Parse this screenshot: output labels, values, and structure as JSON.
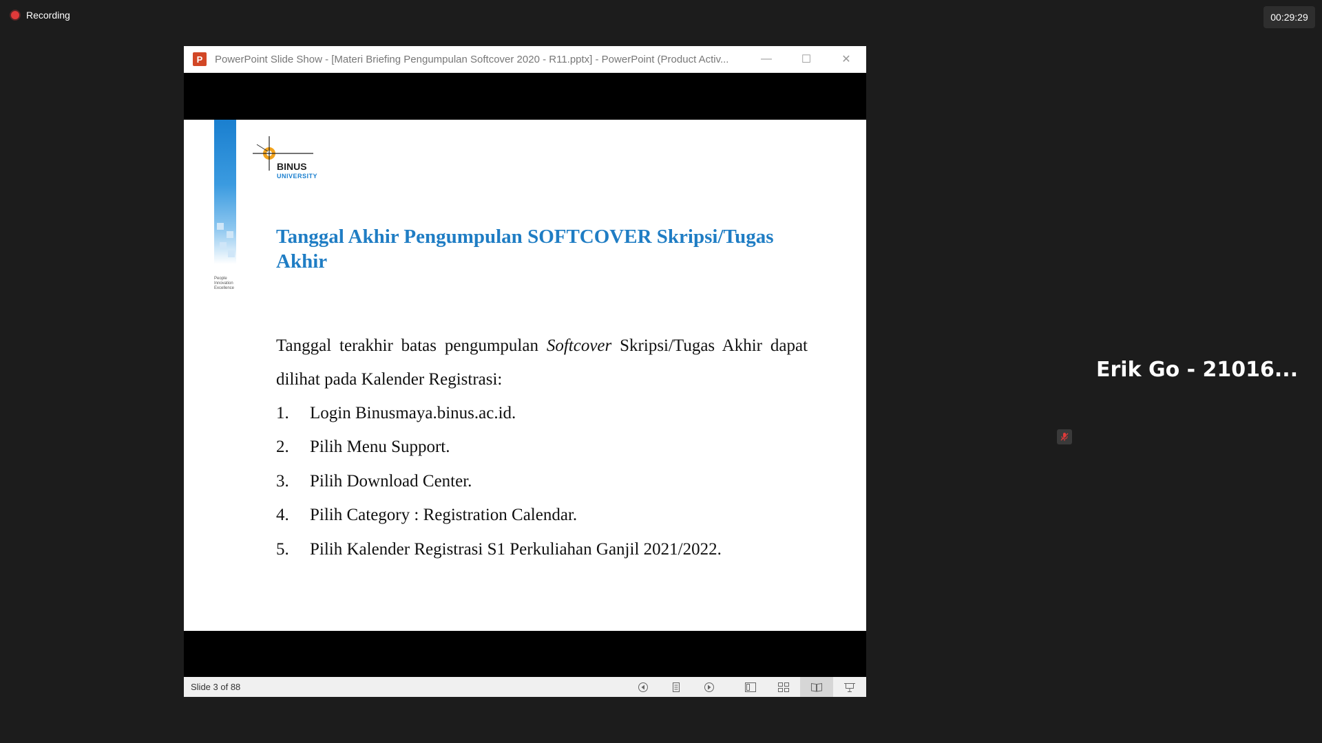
{
  "recording": {
    "label": "Recording"
  },
  "timer": {
    "value": "00:29:29"
  },
  "window": {
    "title": "PowerPoint Slide Show - [Materi Briefing Pengumpulan Softcover 2020 - R11.pptx] - PowerPoint (Product Activ...",
    "app_icon": "P",
    "controls": {
      "minimize": "—",
      "maximize": "☐",
      "close": "✕"
    }
  },
  "slide": {
    "logo": {
      "name": "BINUS",
      "sub": "UNIVERSITY"
    },
    "tagline": [
      "People",
      "Innovation",
      "Excellence"
    ],
    "title": "Tanggal Akhir Pengumpulan SOFTCOVER Skripsi/Tugas Akhir",
    "intro_before": "Tanggal terakhir batas pengumpulan ",
    "intro_italic": "Softcover",
    "intro_after": " Skripsi/Tugas Akhir dapat dilihat pada Kalender Registrasi:",
    "steps": [
      {
        "num": "1.",
        "text": "Login Binusmaya.binus.ac.id."
      },
      {
        "num": "2.",
        "text": "Pilih Menu Support."
      },
      {
        "num": "3.",
        "text": "Pilih Download Center."
      },
      {
        "num": "4.",
        "text": "Pilih Category : Registration Calendar."
      },
      {
        "num": "5.",
        "text": "Pilih Kalender Registrasi S1 Perkuliahan Ganjil 2021/2022."
      }
    ]
  },
  "statusbar": {
    "slide_count": "Slide 3 of 88",
    "icons": [
      "previous-icon",
      "notes-icon",
      "next-icon",
      "normal-view-icon",
      "slide-sorter-icon",
      "reading-view-icon",
      "slideshow-icon"
    ]
  },
  "participant": {
    "name": "Erik Go - 21016..."
  },
  "colors": {
    "accent": "#1f7dc4",
    "record": "#e03a3a",
    "background": "#1c1c1c"
  }
}
